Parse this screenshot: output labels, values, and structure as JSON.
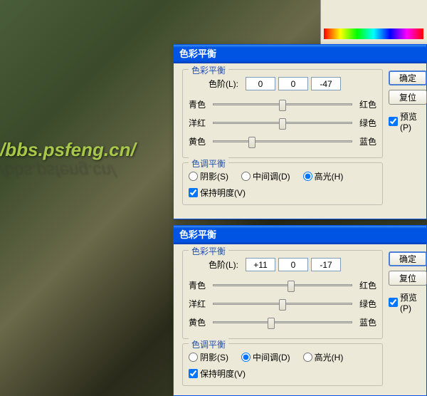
{
  "watermark": "/bbs.psfeng.cn/",
  "dialog1": {
    "title": "色彩平衡",
    "color_balance": {
      "legend": "色彩平衡",
      "level_label": "色阶(L):",
      "values": [
        "0",
        "0",
        "-47"
      ],
      "sliders": [
        {
          "left": "青色",
          "right": "红色",
          "pos": 50
        },
        {
          "left": "洋红",
          "right": "绿色",
          "pos": 50
        },
        {
          "left": "黄色",
          "right": "蓝色",
          "pos": 28
        }
      ]
    },
    "tone_balance": {
      "legend": "色调平衡",
      "shadows": "阴影(S)",
      "midtones": "中间调(D)",
      "highlights": "高光(H)",
      "selected": "highlights",
      "preserve_lum": "保持明度(V)",
      "preserve_checked": true
    },
    "buttons": {
      "ok": "确定",
      "cancel": "复位",
      "preview": "预览(P)",
      "preview_checked": true
    }
  },
  "dialog2": {
    "title": "色彩平衡",
    "color_balance": {
      "legend": "色彩平衡",
      "level_label": "色阶(L):",
      "values": [
        "+11",
        "0",
        "-17"
      ],
      "sliders": [
        {
          "left": "青色",
          "right": "红色",
          "pos": 56
        },
        {
          "left": "洋红",
          "right": "绿色",
          "pos": 50
        },
        {
          "left": "黄色",
          "right": "蓝色",
          "pos": 42
        }
      ]
    },
    "tone_balance": {
      "legend": "色调平衡",
      "shadows": "阴影(S)",
      "midtones": "中间调(D)",
      "highlights": "高光(H)",
      "selected": "midtones",
      "preserve_lum": "保持明度(V)",
      "preserve_checked": true
    },
    "buttons": {
      "ok": "确定",
      "cancel": "复位",
      "preview": "预览(P)",
      "preview_checked": true
    }
  }
}
